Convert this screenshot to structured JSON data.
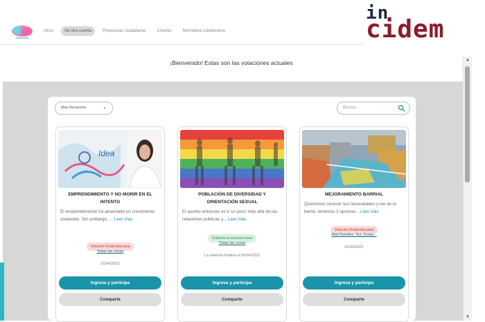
{
  "brand": {
    "line1": "in",
    "line2": "cidem"
  },
  "nav": {
    "items": [
      {
        "label": "Inicio",
        "active": false
      },
      {
        "label": "Sé otra cuenta",
        "active": true
      },
      {
        "label": "Propuestas ciudadanas",
        "active": false
      },
      {
        "label": "Charlas",
        "active": false
      },
      {
        "label": "Normativa colaborativa",
        "active": false
      }
    ]
  },
  "welcome": "¡Bienvenido! Estas son las votaciones actuales",
  "filters": {
    "sort_label": "Más Recientes",
    "search_placeholder": "Buscar..."
  },
  "cards": [
    {
      "title": "EMPRENDIMIENTO Y NO MORIR EN EL INTENTO",
      "desc": "El emprendimiento ha alcanzado un crecimiento sostenido. Sin embargo, ...",
      "more": "Leer más",
      "status": "Votación Finalizada para",
      "zones": "Todas las zonas",
      "date": "01/04/2022",
      "cta": "Ingresa y participa",
      "share": "Comparte"
    },
    {
      "title": "POBLACIÓN DE DIVERSIDAD Y ORIENTACIÓN SEXUAL",
      "desc": "El asunto entonces es ir un poco más allá de las relaciones públicas y...",
      "more": "Leer más",
      "status": "Votación en proceso para",
      "zones": "Todas las zonas",
      "date": "La votación finaliza el 05/04/2022",
      "cta": "Ingresa y participa",
      "share": "Comparte"
    },
    {
      "title": "MEJORAMIENTO BARRIAL",
      "desc": "Queremos conocer tus necesidades y las de tu barrio, tenemos 3 opcione...",
      "more": "Leer más",
      "status": "Votación Finalizada para",
      "zones": "Mas Paredes, Sur, Zonas...",
      "date": "01/04/2022",
      "cta": "Ingresa y participa",
      "share": "Comparte"
    }
  ],
  "colors": {
    "accent": "#1a94a9",
    "finished": "#fbd9d9",
    "in_progress": "#d9f1df",
    "background": "#d7d7d7",
    "brand_red": "#8a1c2b"
  }
}
